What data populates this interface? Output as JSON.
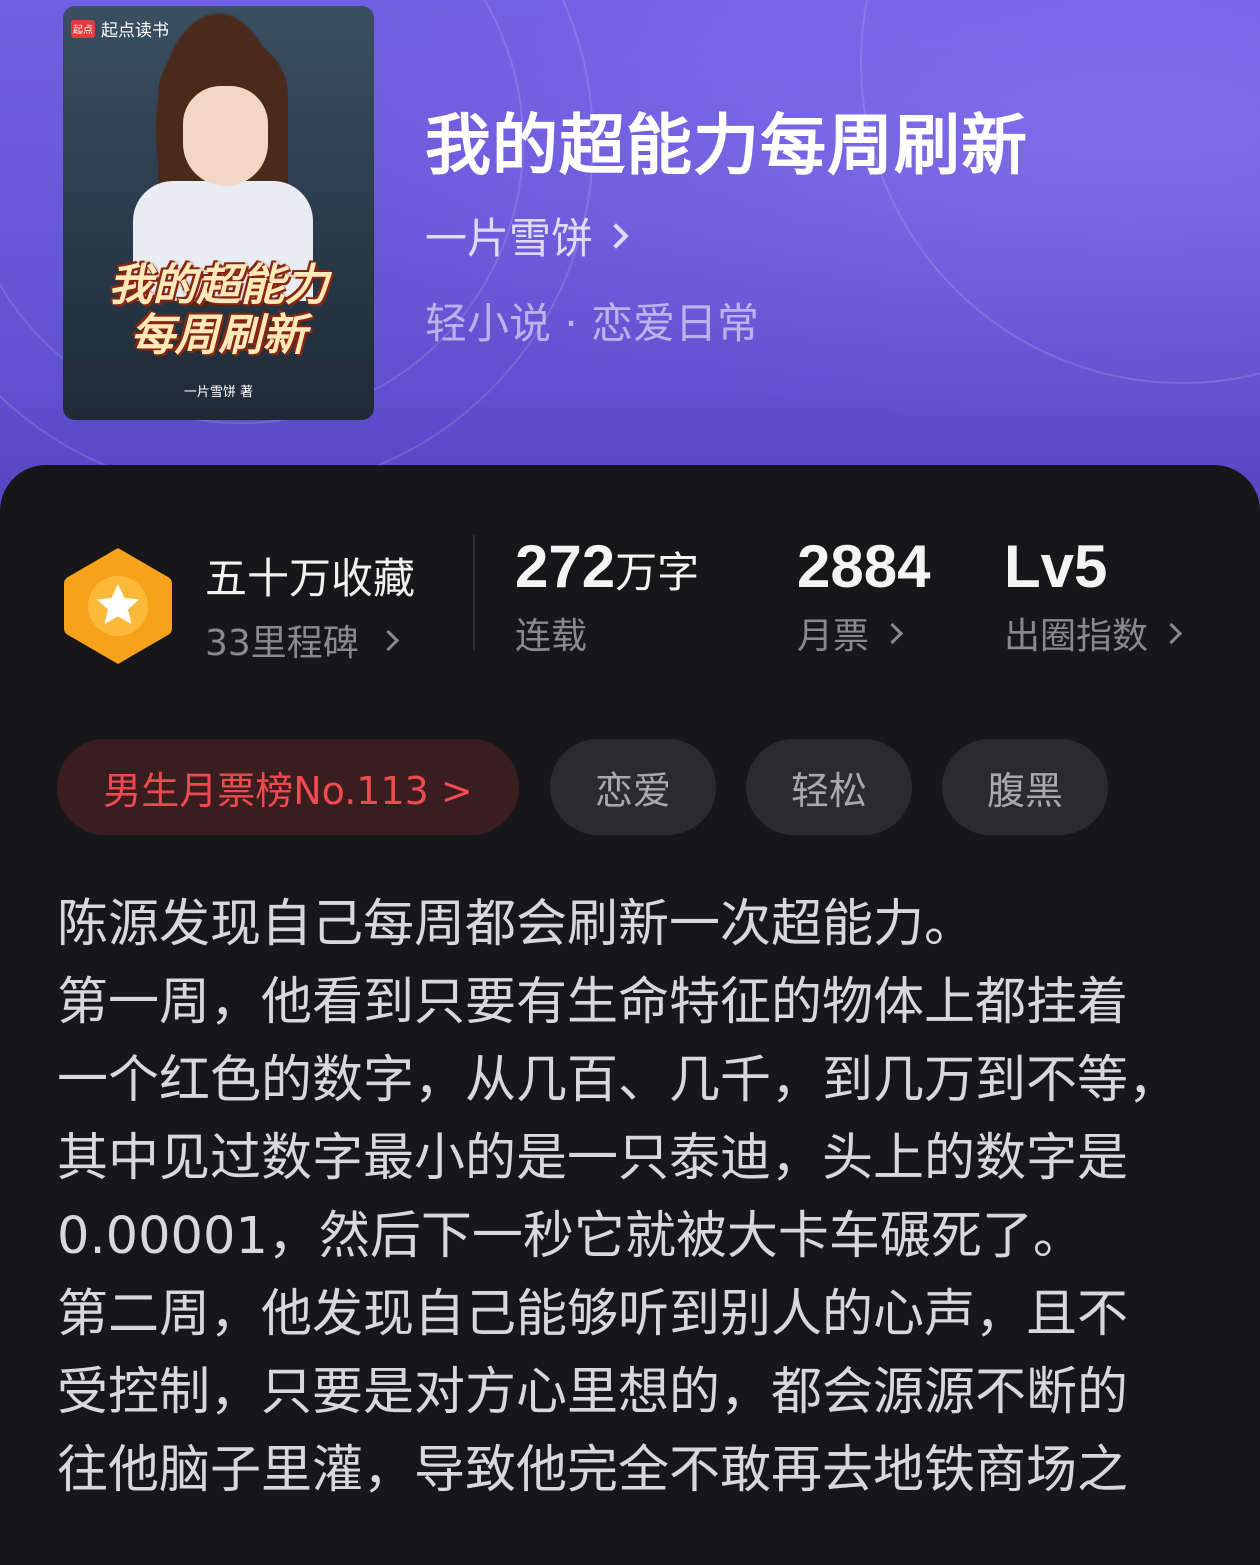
{
  "book": {
    "title": "我的超能力每周刷新",
    "author": "一片雪饼",
    "genre": "轻小说 · 恋爱日常",
    "cover": {
      "brand": "起点读书",
      "brand_logo": "起点",
      "title_line1": "我的超能力",
      "title_line2": "每周刷新",
      "author_small": "一片雪饼 著"
    }
  },
  "stats": {
    "milestone_title": "五十万收藏",
    "milestone_sub": "33里程碑",
    "words_value": "272",
    "words_unit": "万字",
    "words_status": "连载",
    "monthly_tickets_value": "2884",
    "monthly_tickets_label": "月票",
    "level_value": "Lv5",
    "level_label": "出圈指数"
  },
  "tags": {
    "rank": "男生月票榜No.113 >",
    "items": [
      "恋爱",
      "轻松",
      "腹黑"
    ]
  },
  "description": [
    "陈源发现自己每周都会刷新一次超能力。",
    "第一周，他看到只要有生命特征的物体上都挂着",
    "一个红色的数字，从几百、几千，到几万到不等，",
    "其中见过数字最小的是一只泰迪，头上的数字是",
    "0.00001，然后下一秒它就被大卡车碾死了。",
    "第二周，他发现自己能够听到别人的心声，且不",
    "受控制，只要是对方心里想的，都会源源不断的",
    "往他脑子里灌，导致他完全不敢再去地铁商场之"
  ],
  "colors": {
    "header_purple": "#6a59d9",
    "rank_red": "#ef4a50",
    "badge_orange": "#f7a21b"
  }
}
